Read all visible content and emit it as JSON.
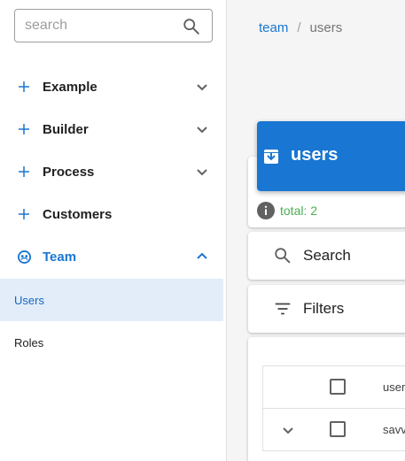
{
  "search": {
    "placeholder": "search"
  },
  "sidebar": {
    "items": [
      {
        "label": "Example",
        "expanded": false
      },
      {
        "label": "Builder",
        "expanded": false
      },
      {
        "label": "Process",
        "expanded": false
      },
      {
        "label": "Customers"
      },
      {
        "label": "Team",
        "expanded": true,
        "active": true
      }
    ],
    "sub_items": [
      {
        "label": "Users",
        "selected": true
      },
      {
        "label": "Roles",
        "selected": false
      }
    ]
  },
  "breadcrumb": {
    "parent": "team",
    "separator": "/",
    "current": "users"
  },
  "header": {
    "title": "users",
    "total": "total: 2"
  },
  "actions": {
    "search_label": "Search",
    "filters_label": "Filters"
  },
  "table": {
    "columns": [
      "user"
    ],
    "rows": [
      {
        "cell": "savv"
      }
    ]
  },
  "colors": {
    "accent": "#1976d2",
    "selected_bg": "#e3edf9",
    "total_green": "#4caf50"
  }
}
